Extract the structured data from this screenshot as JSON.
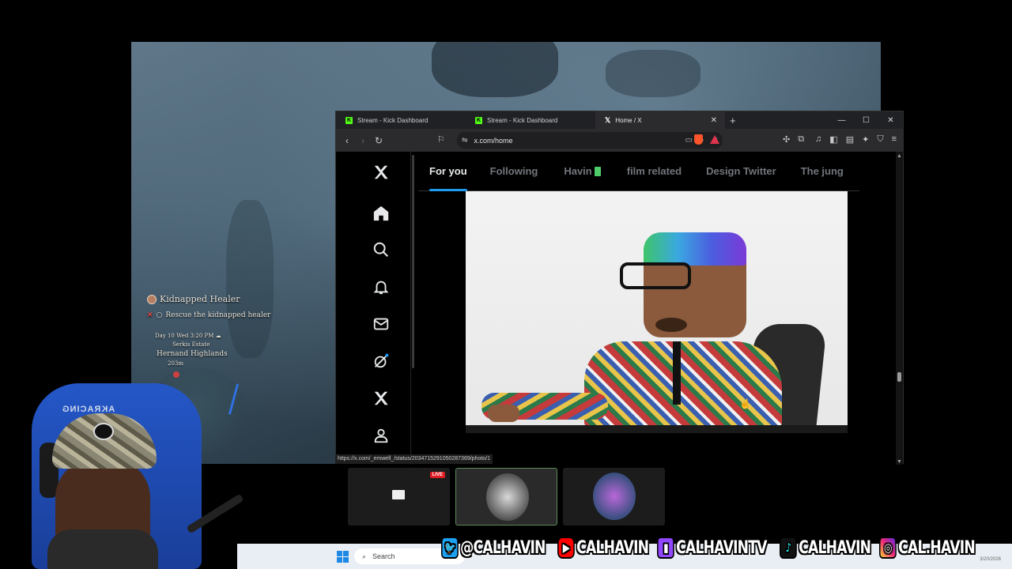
{
  "game": {
    "quest_title": "Kidnapped Healer",
    "quest_objective": "Rescue the kidnapped healer",
    "time": "Day 10 Wed 3:20 PM",
    "location": "Serkis Estate",
    "region": "Hernand Highlands",
    "distance": "203m"
  },
  "browser": {
    "tabs": [
      {
        "label": "Stream - Kick Dashboard",
        "icon": "kick-icon",
        "active": false
      },
      {
        "label": "Stream - Kick Dashboard",
        "icon": "kick-icon",
        "active": false
      },
      {
        "label": "Home / X",
        "icon": "x-logo-icon",
        "active": true
      }
    ],
    "tab_close": "✕",
    "new_tab": "+",
    "url": "x.com/home",
    "status_url": "https://x.com/_emwell_/status/2034715291050287369/photo/1"
  },
  "x": {
    "feed_tabs": [
      {
        "label": "For you",
        "active": true
      },
      {
        "label": "Following",
        "active": false
      },
      {
        "label": "Havin",
        "active": false
      },
      {
        "label": "film related",
        "active": false
      },
      {
        "label": "Design Twitter",
        "active": false
      },
      {
        "label": "The jung",
        "active": false
      }
    ],
    "nav_icons": [
      "x-logo-icon",
      "home-icon",
      "search-icon",
      "bell-icon",
      "mail-icon",
      "grok-icon",
      "x-premium-icon",
      "profile-icon"
    ]
  },
  "thumbnails": {
    "live_badge": "LIVE"
  },
  "taskbar": {
    "search_placeholder": "Search",
    "date": "3/20/2026"
  },
  "socials": [
    {
      "icon": "twitter-icon",
      "handle": "@CALHAVIN"
    },
    {
      "icon": "youtube-icon",
      "handle": "CALHAVIN"
    },
    {
      "icon": "twitch-icon",
      "handle": "CALHAVINTV"
    },
    {
      "icon": "tiktok-icon",
      "handle": "CALHAVIN"
    },
    {
      "icon": "instagram-icon",
      "handle": "CAL.HAVIN"
    }
  ],
  "webcam": {
    "chair_brand": "AKRACING"
  },
  "colors": {
    "x_accent": "#1d9bf0",
    "kick_green": "#53fc18",
    "live_red": "#e01b24"
  }
}
